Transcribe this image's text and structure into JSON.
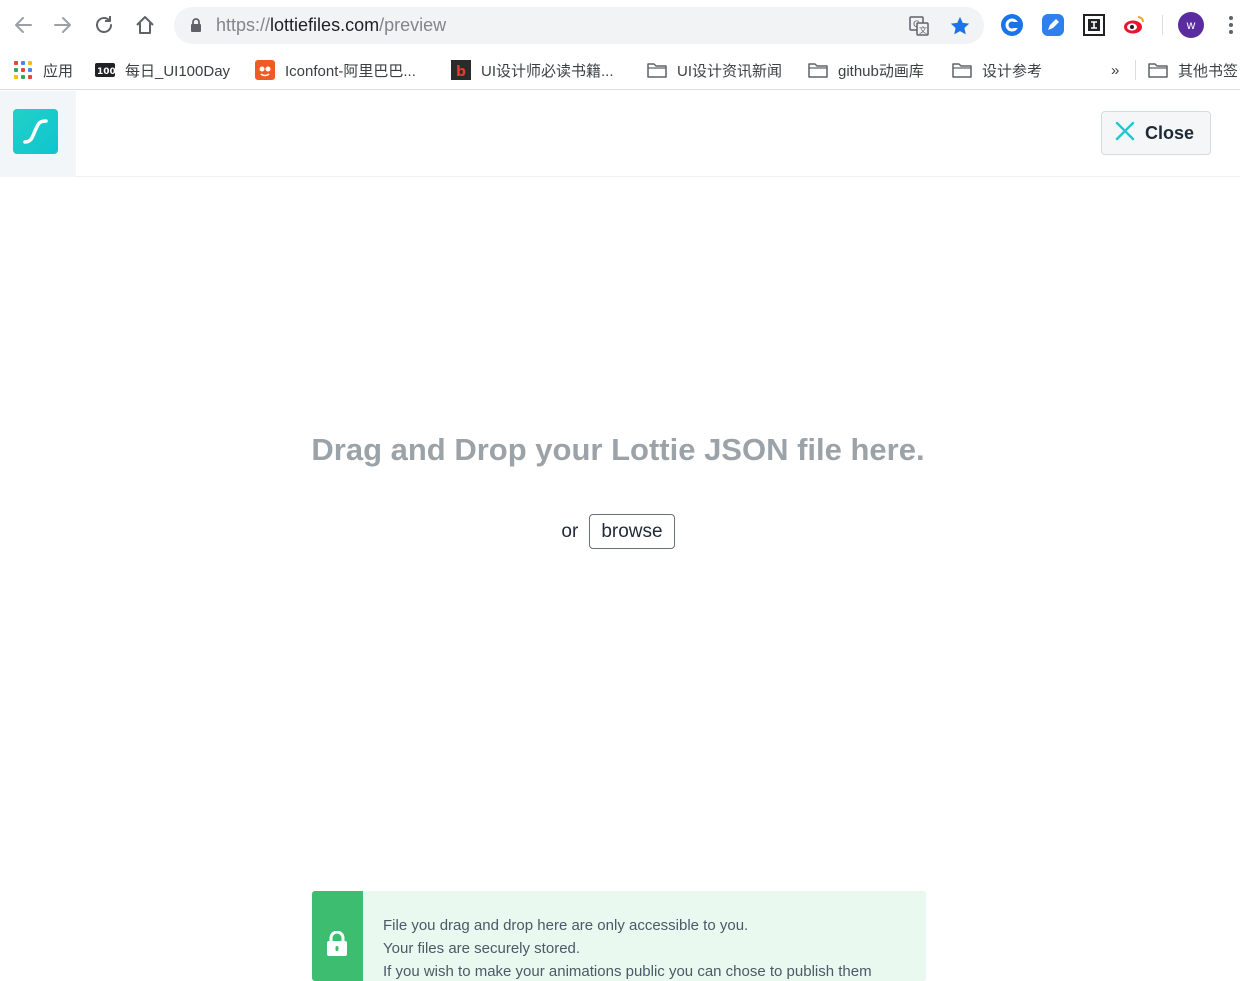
{
  "browser": {
    "url_prefix": "https://",
    "url_host": "lottiefiles.com",
    "url_path": "/preview",
    "avatar_letter": "w",
    "icons": {
      "back": "back-arrow-icon",
      "forward": "forward-arrow-icon",
      "reload": "reload-icon",
      "home": "home-icon",
      "lock": "lock-icon",
      "translate": "translate-icon",
      "bookmark_star": "star-icon",
      "menu": "kebab-menu-icon"
    },
    "colors": {
      "star": "#1a73e8",
      "avatar": "#5b2c9f"
    }
  },
  "bookmarks": {
    "items": [
      {
        "label": "应用",
        "icon": "apps-grid-icon"
      },
      {
        "label": "每日_UI100Day",
        "icon": "ui100-icon"
      },
      {
        "label": "Iconfont-阿里巴巴...",
        "icon": "iconfont-icon"
      },
      {
        "label": "UI设计师必读书籍...",
        "icon": "book-icon"
      },
      {
        "label": "UI设计资讯新闻",
        "icon": "folder-icon"
      },
      {
        "label": "github动画库",
        "icon": "folder-icon"
      },
      {
        "label": "设计参考",
        "icon": "folder-icon"
      },
      {
        "label": "其他书签",
        "icon": "folder-icon"
      }
    ],
    "overflow": "»"
  },
  "header": {
    "close_label": "Close",
    "logo_icon": "lottiefiles-logo-icon",
    "colors": {
      "logo": "#21d1c6",
      "close_x": "#21c7d3"
    }
  },
  "dropzone": {
    "title": "Drag and Drop your Lottie JSON file here.",
    "or": "or",
    "browse": "browse"
  },
  "notice": {
    "lines": [
      "File you drag and drop here are only accessible to you.",
      "Your files are securely stored.",
      "If you wish to make your animations public you can chose to publish them"
    ],
    "icon": "lock-icon",
    "colors": {
      "side": "#3dbd6f",
      "background": "#e9f9ef"
    }
  }
}
